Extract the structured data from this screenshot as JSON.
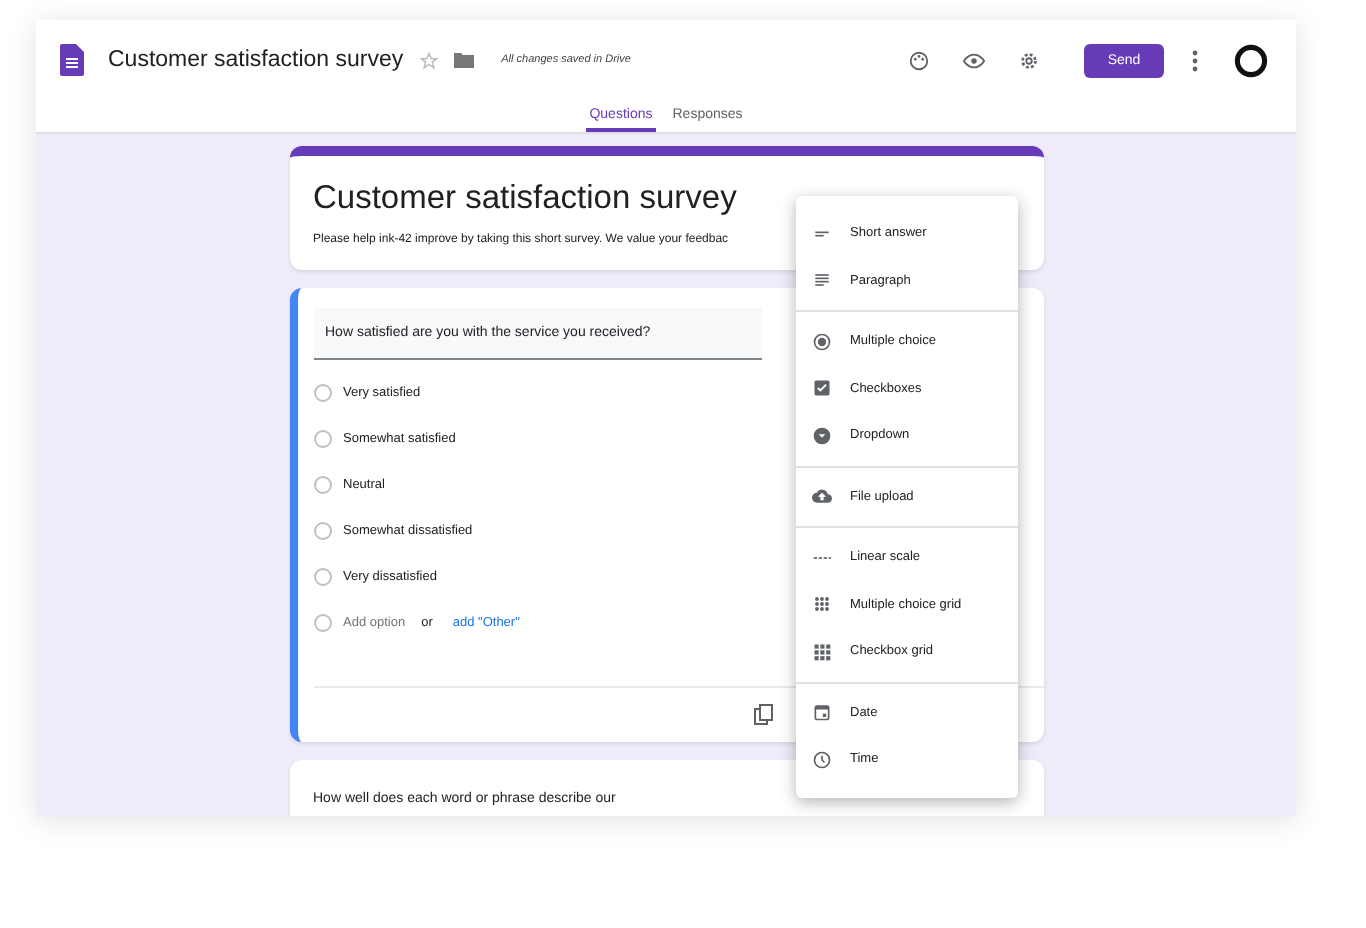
{
  "header": {
    "title": "Customer satisfaction survey",
    "save_status": "All changes saved in Drive",
    "send_label": "Send"
  },
  "tabs": [
    {
      "label": "Questions",
      "selected": true
    },
    {
      "label": "Responses",
      "selected": false
    }
  ],
  "form": {
    "title": "Customer satisfaction survey",
    "description": "Please help ink-42 improve by taking this short survey. We value your feedbac"
  },
  "question": {
    "text": "How satisfied are you with the service you received?",
    "options": [
      {
        "label": "Very satisfied",
        "selected": false
      },
      {
        "label": "Somewhat satisfied",
        "selected": false
      },
      {
        "label": "Neutral",
        "selected": false
      },
      {
        "label": "Somewhat dissatisfied",
        "selected": false
      },
      {
        "label": "Very dissatisfied",
        "selected": false
      }
    ],
    "add_option": {
      "label": "Add option",
      "selected": false
    },
    "or": "or",
    "add_other": "add \"Other\""
  },
  "next_question": {
    "text": "How well does each word or phrase describe our"
  },
  "type_menu": [
    [
      "Short answer",
      "Paragraph"
    ],
    [
      "Multiple choice",
      "Checkboxes",
      "Dropdown"
    ],
    [
      "File upload"
    ],
    [
      "Linear scale",
      "Multiple choice grid",
      "Checkbox grid"
    ],
    [
      "Date",
      "Time"
    ]
  ]
}
